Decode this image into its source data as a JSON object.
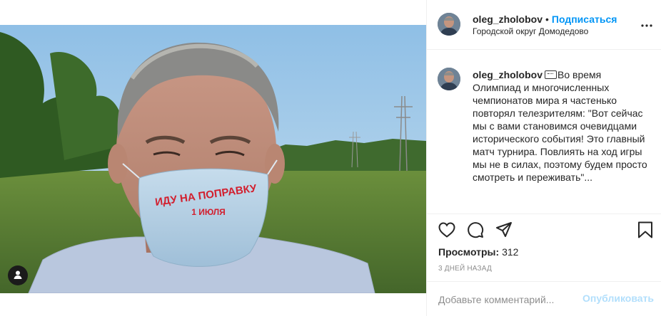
{
  "post": {
    "author": {
      "username": "oleg_zholobov",
      "follow_label": "Подписаться",
      "location": "Городской округ Домодедово",
      "separator": "•"
    },
    "media": {
      "mask_text_line1": "ИДУ НА ПОПРАВКУ",
      "mask_text_line2": "1 ИЮЛЯ",
      "user_tag_icon": "person-icon"
    },
    "caption": {
      "username": "oleg_zholobov",
      "emoji": "speech-balloon",
      "text": "Во время Олимпиад и многочисленных чемпионатов мира я частенько повторял телезрителям: \"Вот сейчас мы с вами становимся очевидцами исторического события! Это главный матч турнира. Повлиять на ход игры мы не в силах, поэтому будем просто смотреть и переживать\"..."
    },
    "actions": {
      "like_icon": "heart-icon",
      "comment_icon": "comment-icon",
      "share_icon": "paper-plane-icon",
      "save_icon": "bookmark-icon",
      "more_icon": "more-dots-icon"
    },
    "views_label": "Просмотры:",
    "views_count": "312",
    "timestamp": "3 ДНЕЙ НАЗАД",
    "comment": {
      "placeholder": "Добавьте комментарий...",
      "value": "",
      "publish_label": "Опубликовать"
    }
  },
  "colors": {
    "accent": "#0095f6",
    "publish_disabled": "#b2dffc",
    "divider": "#efefef",
    "text": "#262626",
    "secondary_text": "#8e8e8e"
  }
}
